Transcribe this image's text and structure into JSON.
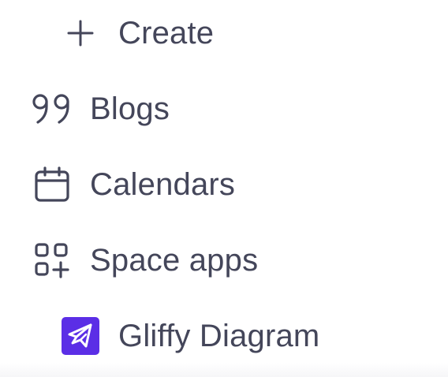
{
  "nav": {
    "items": [
      {
        "label": "Create",
        "icon": "plus-icon"
      },
      {
        "label": "Blogs",
        "icon": "quote-icon"
      },
      {
        "label": "Calendars",
        "icon": "calendar-icon"
      },
      {
        "label": "Space apps",
        "icon": "apps-grid-icon"
      },
      {
        "label": "Gliffy Diagram",
        "icon": "gliffy-logo-icon",
        "icon_color": "#5b2ee6"
      }
    ]
  },
  "colors": {
    "text": "#44465a",
    "icon_stroke": "#44465a",
    "gliffy_brand": "#5b2ee6"
  }
}
